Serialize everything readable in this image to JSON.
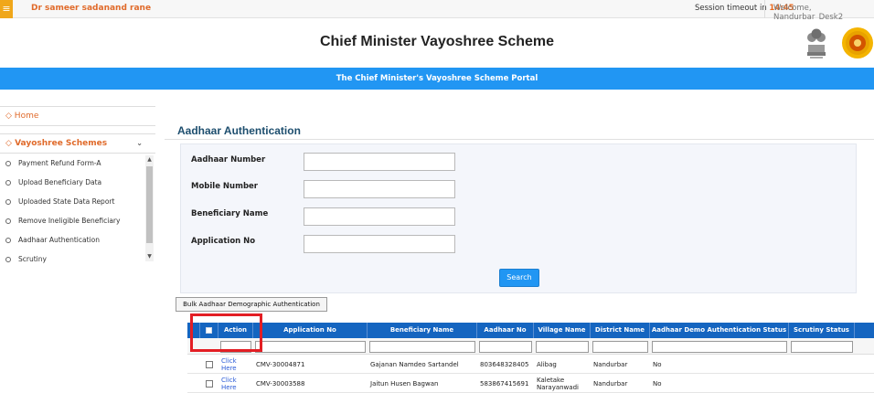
{
  "topbar": {
    "user_name": "Dr sameer sadanand rane",
    "session_label": "Session timeout in",
    "session_time": "14:45",
    "welcome": "Welcome, Nandurbar_Desk2"
  },
  "header": {
    "title": "Chief Minister Vayoshree Scheme",
    "portal_banner": "The Chief Minister's Vayoshree Scheme Portal"
  },
  "sidebar": {
    "home_label": "Home",
    "schemes_label": "Vayoshree Schemes",
    "items": [
      {
        "label": "Payment Refund Form-A"
      },
      {
        "label": "Upload Beneficiary Data"
      },
      {
        "label": "Uploaded State Data Report"
      },
      {
        "label": "Remove Ineligible Beneficiary"
      },
      {
        "label": "Aadhaar Authentication"
      },
      {
        "label": "Scrutiny"
      }
    ]
  },
  "form": {
    "page_title": "Aadhaar Authentication",
    "aadhaar_label": "Aadhaar Number",
    "aadhaar_value": "",
    "mobile_label": "Mobile Number",
    "mobile_value": "",
    "beneficiary_label": "Beneficiary Name",
    "beneficiary_value": "",
    "application_label": "Application No",
    "application_value": "",
    "search_label": "Search",
    "bulk_label": "Bulk Aadhaar Demographic Authentication"
  },
  "table": {
    "headers": {
      "action": "Action",
      "application_no": "Application No",
      "beneficiary_name": "Beneficiary Name",
      "aadhaar_no": "Aadhaar No",
      "village_name": "Village Name",
      "district_name": "District Name",
      "demo_status": "Aadhaar Demo Authentication Status",
      "scrutiny_status": "Scrutiny Status"
    },
    "rows": [
      {
        "action": "Click Here",
        "application_no": "CMV-30004871",
        "beneficiary_name": "Gajanan Namdeo Sartandel",
        "aadhaar_no": "803648328405",
        "village_name": "Alibag",
        "district_name": "Nandurbar",
        "demo_status": "No",
        "scrutiny_status": ""
      },
      {
        "action": "Click Here",
        "application_no": "CMV-30003588",
        "beneficiary_name": "Jaitun Husen Bagwan",
        "aadhaar_no": "583867415691",
        "village_name": "Kaletake Narayanwadi",
        "district_name": "Nandurbar",
        "demo_status": "No",
        "scrutiny_status": ""
      }
    ]
  },
  "icons": {
    "menu": "hamburger-icon",
    "emblem": "state-emblem-icon",
    "seal": "government-seal-icon",
    "home": "home-icon",
    "schemes": "schemes-icon",
    "submenu_bullet": "circle-bullet-icon"
  },
  "colors": {
    "accent_orange": "#e06a2a",
    "banner_blue": "#2196f3",
    "table_header_blue": "#1565c0",
    "highlight_red": "#e31e24"
  }
}
